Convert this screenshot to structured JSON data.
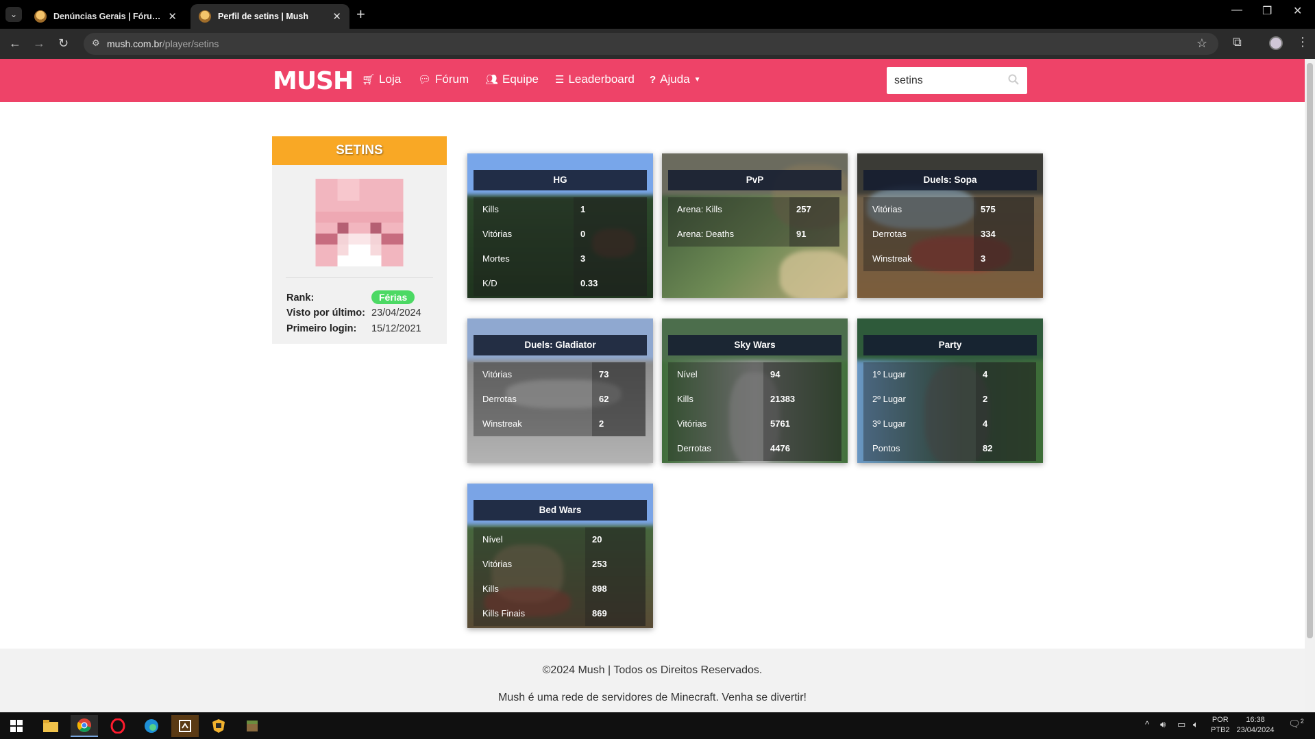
{
  "browser": {
    "tabs": [
      {
        "title": "Denúncias Gerais | Fórum Mush",
        "active": false
      },
      {
        "title": "Perfil de setins | Mush",
        "active": true
      }
    ],
    "url_host": "mush.com.br",
    "url_path": "/player/setins"
  },
  "site": {
    "logo": "MUSH",
    "nav": [
      {
        "label": "Loja",
        "icon": "cart-icon"
      },
      {
        "label": "Fórum",
        "icon": "comments-icon"
      },
      {
        "label": "Equipe",
        "icon": "users-icon"
      },
      {
        "label": "Leaderboard",
        "icon": "list-icon"
      },
      {
        "label": "Ajuda",
        "icon": "question-icon"
      }
    ],
    "search_value": "setins"
  },
  "profile": {
    "name": "SETINS",
    "rank_label": "Rank:",
    "rank": "Férias",
    "last_seen_label": "Visto por último:",
    "last_seen": "23/04/2024",
    "first_login_label": "Primeiro login:",
    "first_login": "15/12/2021",
    "colors": {
      "header": "#f9a825",
      "rank_badge": "#4cd964"
    }
  },
  "cards": [
    {
      "title": "HG",
      "rows": [
        [
          "Kills",
          "1"
        ],
        [
          "Vitórias",
          "0"
        ],
        [
          "Mortes",
          "3"
        ],
        [
          "K/D",
          "0.33"
        ]
      ]
    },
    {
      "title": "PvP",
      "rows": [
        [
          "Arena: Kills",
          "257"
        ],
        [
          "Arena: Deaths",
          "91"
        ]
      ]
    },
    {
      "title": "Duels: Sopa",
      "rows": [
        [
          "Vitórias",
          "575"
        ],
        [
          "Derrotas",
          "334"
        ],
        [
          "Winstreak",
          "3"
        ]
      ]
    },
    {
      "title": "Duels: Gladiator",
      "rows": [
        [
          "Vitórias",
          "73"
        ],
        [
          "Derrotas",
          "62"
        ],
        [
          "Winstreak",
          "2"
        ]
      ]
    },
    {
      "title": "Sky Wars",
      "rows": [
        [
          "Nível",
          "94"
        ],
        [
          "Kills",
          "21383"
        ],
        [
          "Vitórias",
          "5761"
        ],
        [
          "Derrotas",
          "4476"
        ]
      ]
    },
    {
      "title": "Party",
      "rows": [
        [
          "1º Lugar",
          "4"
        ],
        [
          "2º Lugar",
          "2"
        ],
        [
          "3º Lugar",
          "4"
        ],
        [
          "Pontos",
          "82"
        ]
      ]
    },
    {
      "title": "Bed Wars",
      "rows": [
        [
          "Nível",
          "20"
        ],
        [
          "Vitórias",
          "253"
        ],
        [
          "Kills",
          "898"
        ],
        [
          "Kills Finais",
          "869"
        ]
      ]
    }
  ],
  "footer": {
    "copyright": "©2024 Mush | Todos os Direitos Reservados.",
    "tagline": "Mush é uma rede de servidores de Minecraft. Venha se divertir!"
  },
  "taskbar": {
    "lang": "POR",
    "layout": "PTB2",
    "time": "16:38",
    "date": "23/04/2024",
    "notifications": "2"
  },
  "theme": {
    "brand": "#ee4368"
  }
}
